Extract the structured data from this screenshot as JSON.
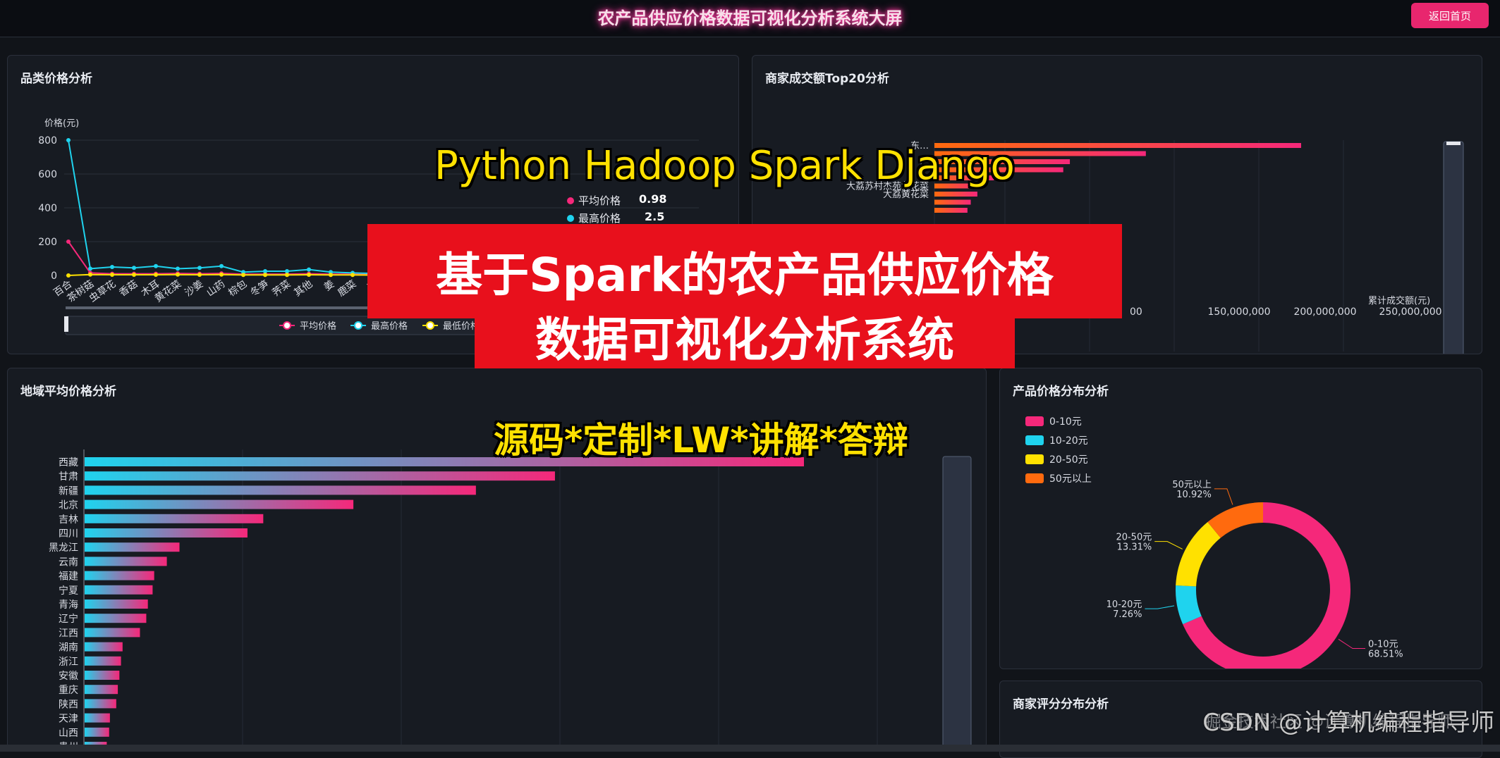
{
  "header": {
    "title": "农产品供应价格数据可视化分析系统大屏",
    "back_label": "返回首页"
  },
  "panels": {
    "category_title": "品类价格分析",
    "merchant_title": "商家成交额Top20分析",
    "region_title": "地域平均价格分析",
    "price_dist_title": "产品价格分布分析",
    "rating_title": "商家评分分布分析"
  },
  "overlay": {
    "tech": "Python Hadoop Spark Django",
    "line1": "基于Spark的农产品供应价格",
    "line2": "数据可视化分析系统",
    "services": "源码*定制*LW*讲解*答辩"
  },
  "watermark": "CSDN @计算机编程指导师",
  "watermark_faint": "掘金技术社区 @计算机编程指导师",
  "tooltip": {
    "avg_label": "平均价格",
    "avg_value": "0.98",
    "max_label": "最高价格",
    "max_value": "2.5"
  },
  "colors": {
    "pink": "#f5287a",
    "cyan": "#1fd3ee",
    "yellow": "#ffe100",
    "orange": "#ff6a0e"
  },
  "chart_data": [
    {
      "type": "line",
      "ylabel": "价格(元)",
      "ylim": [
        0,
        800
      ],
      "yticks": [
        "0",
        "200",
        "400",
        "600",
        "800"
      ],
      "categories": [
        "百合",
        "茶树菇",
        "虫草花",
        "香菇",
        "木耳",
        "黄花菜",
        "沙姜",
        "山药",
        "棕包",
        "冬笋",
        "荠菜",
        "其他",
        "姜",
        "鹿菜",
        "蔓"
      ],
      "series": [
        {
          "name": "平均价格",
          "color": "#f5287a",
          "values": [
            200,
            15,
            10,
            10,
            10,
            12,
            10,
            12,
            8,
            8,
            8,
            10,
            8,
            8,
            6
          ]
        },
        {
          "name": "最高价格",
          "color": "#1fd3ee",
          "values": [
            800,
            40,
            50,
            45,
            55,
            40,
            45,
            55,
            20,
            25,
            25,
            35,
            20,
            15,
            12
          ]
        },
        {
          "name": "最低价格",
          "color": "#ffe100",
          "values": [
            0,
            5,
            4,
            4,
            4,
            5,
            4,
            5,
            3,
            3,
            3,
            4,
            3,
            3,
            2
          ]
        }
      ]
    },
    {
      "type": "bar",
      "orientation": "horizontal",
      "xlabel": "累计成交额(元)",
      "xticks": [
        "00",
        "150,000,000",
        "200,000,000",
        "250,000,000"
      ],
      "categories": [
        "东…",
        "",
        "…",
        "",
        "…",
        "大荔苏村杰苑黄花菜",
        "大荔黄花菜",
        "",
        ""
      ],
      "values": [
        222000000,
        128000000,
        82000000,
        78000000,
        36000000,
        28000000,
        26000000,
        22000000,
        20000000
      ]
    },
    {
      "type": "bar",
      "orientation": "horizontal",
      "categories": [
        "西藏",
        "甘肃",
        "新疆",
        "北京",
        "吉林",
        "四川",
        "黑龙江",
        "云南",
        "福建",
        "宁夏",
        "青海",
        "辽宁",
        "江西",
        "湖南",
        "浙江",
        "安徽",
        "重庆",
        "陕西",
        "天津",
        "山西",
        "贵州"
      ],
      "values": [
        910,
        595,
        495,
        340,
        226,
        206,
        120,
        104,
        88,
        86,
        80,
        78,
        70,
        48,
        46,
        44,
        42,
        40,
        32,
        31,
        28
      ]
    },
    {
      "type": "pie",
      "donut": true,
      "legend_position": "top-left",
      "slices": [
        {
          "label": "0-10元",
          "value": 68.51,
          "color": "#f5287a"
        },
        {
          "label": "10-20元",
          "value": 7.26,
          "color": "#1fd3ee"
        },
        {
          "label": "20-50元",
          "value": 13.31,
          "color": "#ffe100"
        },
        {
          "label": "50元以上",
          "value": 10.92,
          "color": "#ff6a0e"
        }
      ]
    }
  ]
}
